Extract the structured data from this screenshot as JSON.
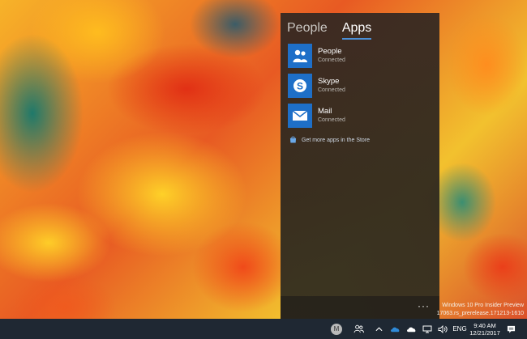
{
  "flyout": {
    "tabs": [
      {
        "label": "People",
        "active": false
      },
      {
        "label": "Apps",
        "active": true
      }
    ],
    "apps": [
      {
        "name": "People",
        "status": "Connected",
        "icon": "people-icon"
      },
      {
        "name": "Skype",
        "status": "Connected",
        "icon": "skype-icon"
      },
      {
        "name": "Mail",
        "status": "Connected",
        "icon": "mail-icon"
      }
    ],
    "store_link": "Get more apps in the Store",
    "more_label": "···"
  },
  "watermark": {
    "line1": "Windows 10 Pro Insider Preview",
    "line2": "17063.rs_prerelease.171213-1610"
  },
  "taskbar": {
    "avatar_letter": "M",
    "language": "ENG",
    "time": "9:40 AM",
    "date": "12/21/2017"
  },
  "colors": {
    "accent": "#1e6fc8",
    "taskbar": "#1f2833",
    "tab_underline": "#4b8fd6"
  }
}
